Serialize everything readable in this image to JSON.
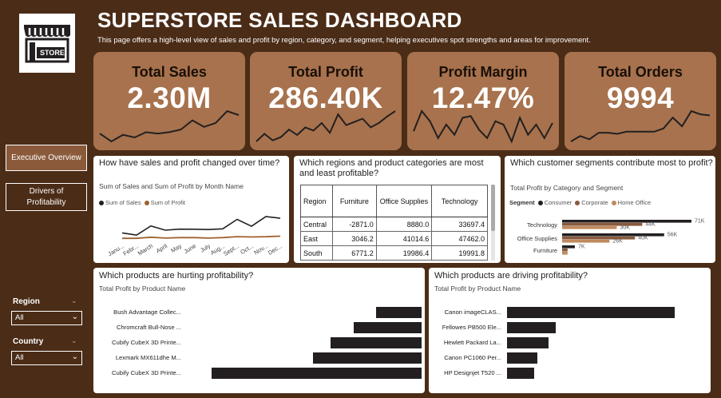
{
  "header": {
    "title": "SUPERSTORE SALES DASHBOARD",
    "subtitle": "This page offers a high-level view of sales and profit by region, category, and segment, helping executives spot strengths and areas for improvement."
  },
  "logo": {
    "text": "STORE"
  },
  "nav": {
    "executive_overview": "Executive Overview",
    "drivers_line1": "Drivers of",
    "drivers_line2": "Profitability"
  },
  "filters": {
    "region_label": "Region",
    "region_value": "All",
    "country_label": "Country",
    "country_value": "All"
  },
  "kpis": [
    {
      "label": "Total Sales",
      "value": "2.30M",
      "sparkline": [
        10,
        4,
        9,
        7,
        11,
        10,
        11,
        13,
        20,
        15,
        18,
        27,
        24
      ]
    },
    {
      "label": "Total Profit",
      "value": "286.40K",
      "sparkline": [
        5,
        12,
        6,
        9,
        16,
        11,
        18,
        15,
        22,
        13,
        30,
        20,
        23,
        26,
        18,
        22,
        28,
        33
      ]
    },
    {
      "label": "Profit Margin",
      "value": "12.47%",
      "sparkline": [
        16,
        28,
        22,
        12,
        20,
        14,
        24,
        25,
        17,
        12,
        22,
        20,
        10,
        24,
        14,
        20,
        12,
        21
      ]
    },
    {
      "label": "Total Orders",
      "value": "9994",
      "sparkline": [
        8,
        13,
        10,
        16,
        16,
        15,
        17,
        17,
        17,
        17,
        20,
        30,
        22,
        36,
        33,
        32
      ]
    }
  ],
  "panel_trend": {
    "question": "How have sales and profit changed over time?",
    "subtitle": "Sum of Sales and Sum of Profit by Month Name",
    "legend_sales": "Sum of Sales",
    "legend_profit": "Sum of Profit"
  },
  "panel_regions": {
    "question": "Which regions and product categories are most and least profitable?",
    "columns": [
      "Region",
      "Furniture",
      "Office Supplies",
      "Technology"
    ],
    "rows": [
      [
        "Central",
        "-2871.0",
        "8880.0",
        "33697.4"
      ],
      [
        "East",
        "3046.2",
        "41014.6",
        "47462.0"
      ],
      [
        "South",
        "6771.2",
        "19986.4",
        "19991.8"
      ]
    ]
  },
  "panel_segments": {
    "question": "Which customer segments contribute most to profit?",
    "subtitle": "Total Profit by Category and Segment",
    "legend_title": "Segment",
    "legend_consumer": "Consumer",
    "legend_corporate": "Corporate",
    "legend_home": "Home Office"
  },
  "panel_hurting": {
    "question": "Which products are hurting profitability?",
    "subtitle": "Total Profit by Product Name"
  },
  "panel_driving": {
    "question": "Which products are driving profitability?",
    "subtitle": "Total Profit by Product Name"
  },
  "colors": {
    "brand_dark": "#4b2c17",
    "brand_card": "#a7724d",
    "consumer": "#231f20",
    "corporate": "#8a5a3b",
    "home_office": "#c08a5e",
    "profit_line": "#a0622f"
  },
  "chart_data": [
    {
      "type": "line",
      "title": "Sum of Sales and Sum of Profit by Month Name",
      "categories": [
        "January",
        "February",
        "March",
        "April",
        "May",
        "June",
        "July",
        "August",
        "September",
        "October",
        "November",
        "December"
      ],
      "category_labels": [
        "Janu...",
        "Febr...",
        "March",
        "April",
        "May",
        "June",
        "July",
        "Aug...",
        "Sept...",
        "Oct...",
        "Nov...",
        "Dec..."
      ],
      "series": [
        {
          "name": "Sum of Sales",
          "values": [
            95000,
            60000,
            205000,
            138000,
            155000,
            153000,
            148000,
            160000,
            308000,
            200000,
            352000,
            325000
          ]
        },
        {
          "name": "Sum of Profit",
          "values": [
            10000,
            10000,
            28000,
            14000,
            22000,
            22000,
            14000,
            22000,
            36000,
            31000,
            35000,
            44000
          ]
        }
      ]
    },
    {
      "type": "bar",
      "title": "Total Profit by Category and Segment",
      "categories": [
        "Technology",
        "Office Supplies",
        "Furniture"
      ],
      "series": [
        {
          "name": "Consumer",
          "values": [
            71,
            56,
            7
          ],
          "labels": [
            "71K",
            "56K",
            "7K"
          ]
        },
        {
          "name": "Corporate",
          "values": [
            44,
            40,
            3
          ],
          "labels": [
            "44K",
            "40K",
            ""
          ]
        },
        {
          "name": "Home Office",
          "values": [
            30,
            26,
            3
          ],
          "labels": [
            "30K",
            "26K",
            ""
          ]
        }
      ]
    },
    {
      "type": "bar",
      "title": "Total Profit by Product Name",
      "categories": [
        "Bush Advantage Collec...",
        "Chromcraft Bull-Nose ...",
        "Cubify CubeX 3D Printe...",
        "Lexmark MX611dhe M...",
        "Cubify CubeX 3D Printe..."
      ],
      "values": [
        -1934,
        -2876,
        -3840,
        -4590,
        -8880
      ]
    },
    {
      "type": "bar",
      "title": "Total Profit by Product Name",
      "categories": [
        "Canon imageCLAS...",
        "Fellowes PB500 Ele...",
        "Hewlett Packard La...",
        "Canon PC1060 Per...",
        "HP Designjet T520 ..."
      ],
      "values": [
        25200,
        7300,
        6200,
        4600,
        4100
      ]
    }
  ]
}
